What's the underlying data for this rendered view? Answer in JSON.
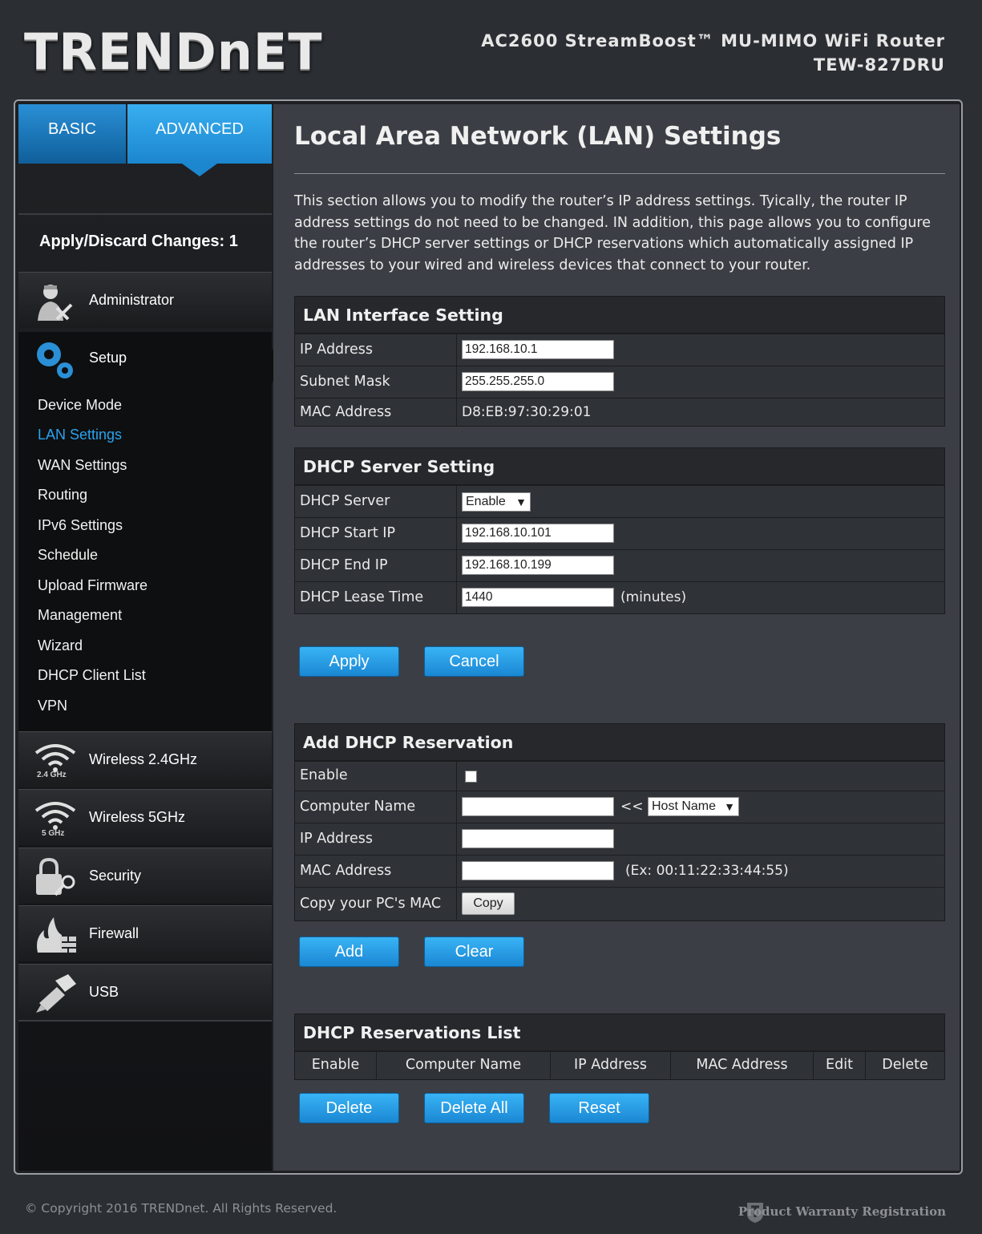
{
  "header": {
    "logo": "TRENDnET",
    "product_line1": "AC2600 StreamBoost™ MU-MIMO WiFi Router",
    "product_line2": "TEW-827DRU"
  },
  "tabs": {
    "basic": "BASIC",
    "advanced": "ADVANCED"
  },
  "sidebar": {
    "apply_changes": "Apply/Discard Changes: 1",
    "administrator": "Administrator",
    "setup": "Setup",
    "setup_items": [
      "Device Mode",
      "LAN Settings",
      "WAN Settings",
      "Routing",
      "IPv6 Settings",
      "Schedule",
      "Upload Firmware",
      "Management",
      "Wizard",
      "DHCP Client List",
      "VPN"
    ],
    "wireless24": "Wireless 2.4GHz",
    "wireless24_badge": "2.4 GHz",
    "wireless5": "Wireless 5GHz",
    "wireless5_badge": "5 GHz",
    "security": "Security",
    "firewall": "Firewall",
    "usb": "USB"
  },
  "page": {
    "title": "Local Area Network (LAN) Settings",
    "intro": "This section allows you to modify the router’s IP address settings. Tyically, the router IP address settings do not need to be changed. IN addition, this page allows you to configure the router’s DHCP server settings or DHCP reservations which automatically assigned IP addresses to your wired and wireless devices that connect to your router."
  },
  "lan": {
    "heading": "LAN Interface Setting",
    "ip_label": "IP Address",
    "ip_value": "192.168.10.1",
    "mask_label": "Subnet Mask",
    "mask_value": "255.255.255.0",
    "mac_label": "MAC Address",
    "mac_value": "D8:EB:97:30:29:01"
  },
  "dhcp": {
    "heading": "DHCP Server Setting",
    "server_label": "DHCP Server",
    "server_value": "Enable",
    "start_label": "DHCP Start IP",
    "start_value": "192.168.10.101",
    "end_label": "DHCP End IP",
    "end_value": "192.168.10.199",
    "lease_label": "DHCP Lease Time",
    "lease_value": "1440",
    "lease_unit": "(minutes)"
  },
  "buttons": {
    "apply": "Apply",
    "cancel": "Cancel",
    "add": "Add",
    "clear": "Clear",
    "delete": "Delete",
    "delete_all": "Delete All",
    "reset": "Reset",
    "copy": "Copy"
  },
  "reservation": {
    "heading": "Add DHCP Reservation",
    "enable_label": "Enable",
    "computer_label": "Computer Name",
    "arrows": "<<",
    "host_select": "Host Name",
    "ip_label": "IP Address",
    "mac_label": "MAC Address",
    "mac_hint": "(Ex: 00:11:22:33:44:55)",
    "copy_label": "Copy your PC's MAC"
  },
  "res_list": {
    "heading": "DHCP Reservations List",
    "columns": [
      "Enable",
      "Computer Name",
      "IP Address",
      "MAC Address",
      "Edit",
      "Delete"
    ]
  },
  "footer": {
    "copyright": "© Copyright 2016 TRENDnet. All Rights Reserved.",
    "warranty": "Product Warranty Registration"
  }
}
